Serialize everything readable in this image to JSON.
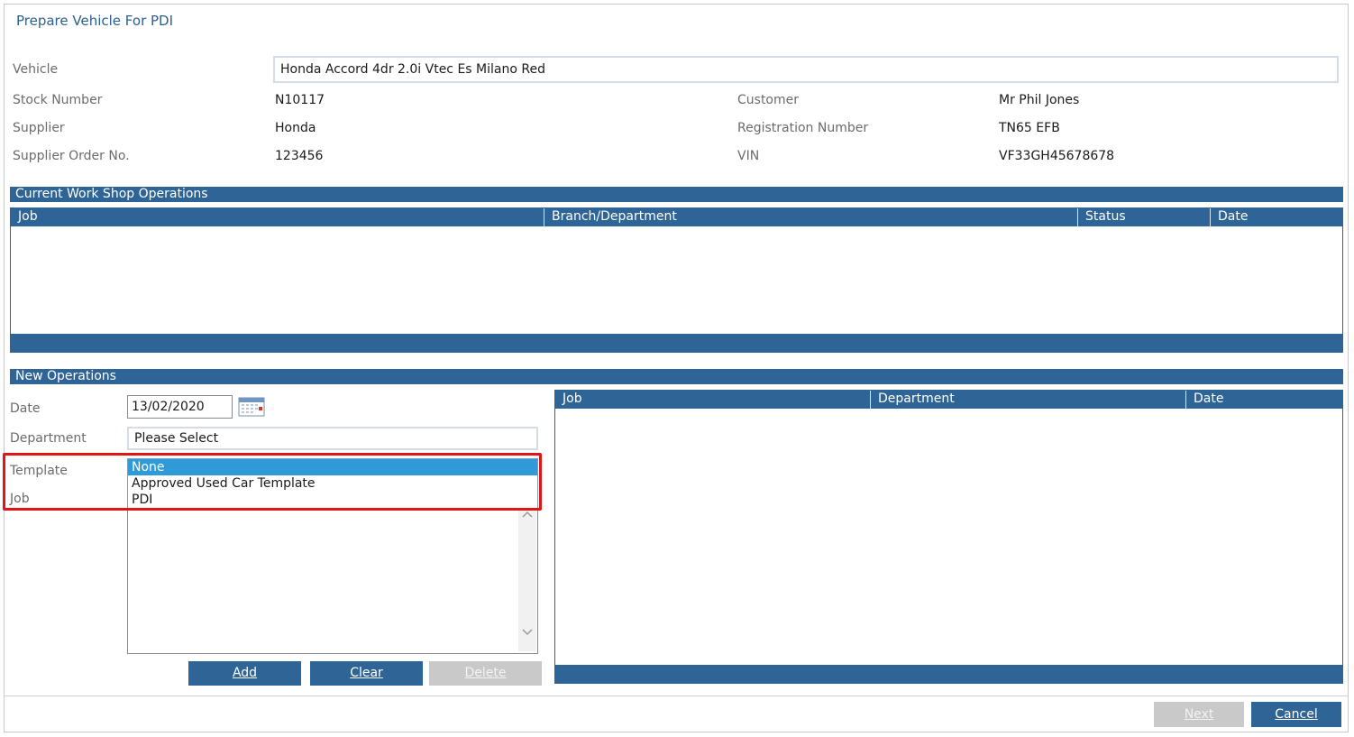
{
  "window": {
    "title": "Prepare Vehicle For PDI"
  },
  "vehicle": {
    "label": "Vehicle",
    "value": "Honda Accord 4dr 2.0i Vtec Es Milano Red"
  },
  "details_left": [
    {
      "label": "Stock Number",
      "value": "N10117"
    },
    {
      "label": "Supplier",
      "value": "Honda"
    },
    {
      "label": "Supplier Order No.",
      "value": "123456"
    }
  ],
  "details_right": [
    {
      "label": "Customer",
      "value": "Mr Phil Jones"
    },
    {
      "label": "Registration Number",
      "value": "TN65 EFB"
    },
    {
      "label": "VIN",
      "value": "VF33GH45678678"
    }
  ],
  "current_ops": {
    "title": "Current Work Shop Operations",
    "columns": [
      "Job",
      "Branch/Department",
      "Status",
      "Date"
    ],
    "rows": []
  },
  "new_ops": {
    "title": "New Operations",
    "date_label": "Date",
    "date_value": "13/02/2020",
    "department_label": "Department",
    "department_value": "Please Select",
    "template_label": "Template",
    "job_label": "Job",
    "template_options": [
      "None",
      "Approved Used Car Template",
      "PDI"
    ],
    "template_selected": "None",
    "buttons": {
      "add": "Add",
      "clear": "Clear",
      "delete": "Delete"
    },
    "grid_columns": [
      "Job",
      "Department",
      "Date"
    ],
    "grid_rows": []
  },
  "footer": {
    "next": "Next",
    "cancel": "Cancel"
  },
  "colors": {
    "accent": "#2f6496",
    "selected": "#2f9ad8",
    "highlight": "#e01515",
    "disabled": "#c9c9c9"
  }
}
